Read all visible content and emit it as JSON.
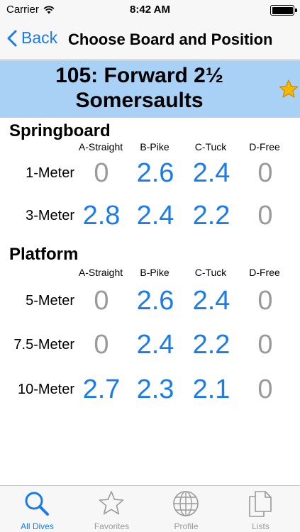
{
  "status_bar": {
    "carrier": "Carrier",
    "time": "8:42 AM",
    "battery_level": 1.0
  },
  "nav": {
    "back_label": "Back",
    "title": "Choose Board and Position"
  },
  "dive": {
    "title_line1": "105: Forward 2½",
    "title_line2": "Somersaults",
    "favorite": true
  },
  "columns": [
    "A-Straight",
    "B-Pike",
    "C-Tuck",
    "D-Free"
  ],
  "springboard": {
    "title": "Springboard",
    "rows": [
      {
        "label": "1-Meter",
        "values": [
          "0",
          "2.6",
          "2.4",
          "0"
        ]
      },
      {
        "label": "3-Meter",
        "values": [
          "2.8",
          "2.4",
          "2.2",
          "0"
        ]
      }
    ]
  },
  "platform": {
    "title": "Platform",
    "rows": [
      {
        "label": "5-Meter",
        "values": [
          "0",
          "2.6",
          "2.4",
          "0"
        ]
      },
      {
        "label": "7.5-Meter",
        "values": [
          "0",
          "2.4",
          "2.2",
          "0"
        ]
      },
      {
        "label": "10-Meter",
        "values": [
          "2.7",
          "2.3",
          "2.1",
          "0"
        ]
      }
    ]
  },
  "tabs": [
    {
      "label": "All Dives",
      "icon": "search-icon",
      "active": true
    },
    {
      "label": "Favorites",
      "icon": "star-icon",
      "active": false
    },
    {
      "label": "Profile",
      "icon": "globe-icon",
      "active": false
    },
    {
      "label": "Lists",
      "icon": "documents-icon",
      "active": false
    }
  ],
  "colors": {
    "accent": "#1a7bea",
    "banner": "#a9d0f5",
    "inactive": "#9a9a9a",
    "favorite_star": "#f5b800"
  }
}
